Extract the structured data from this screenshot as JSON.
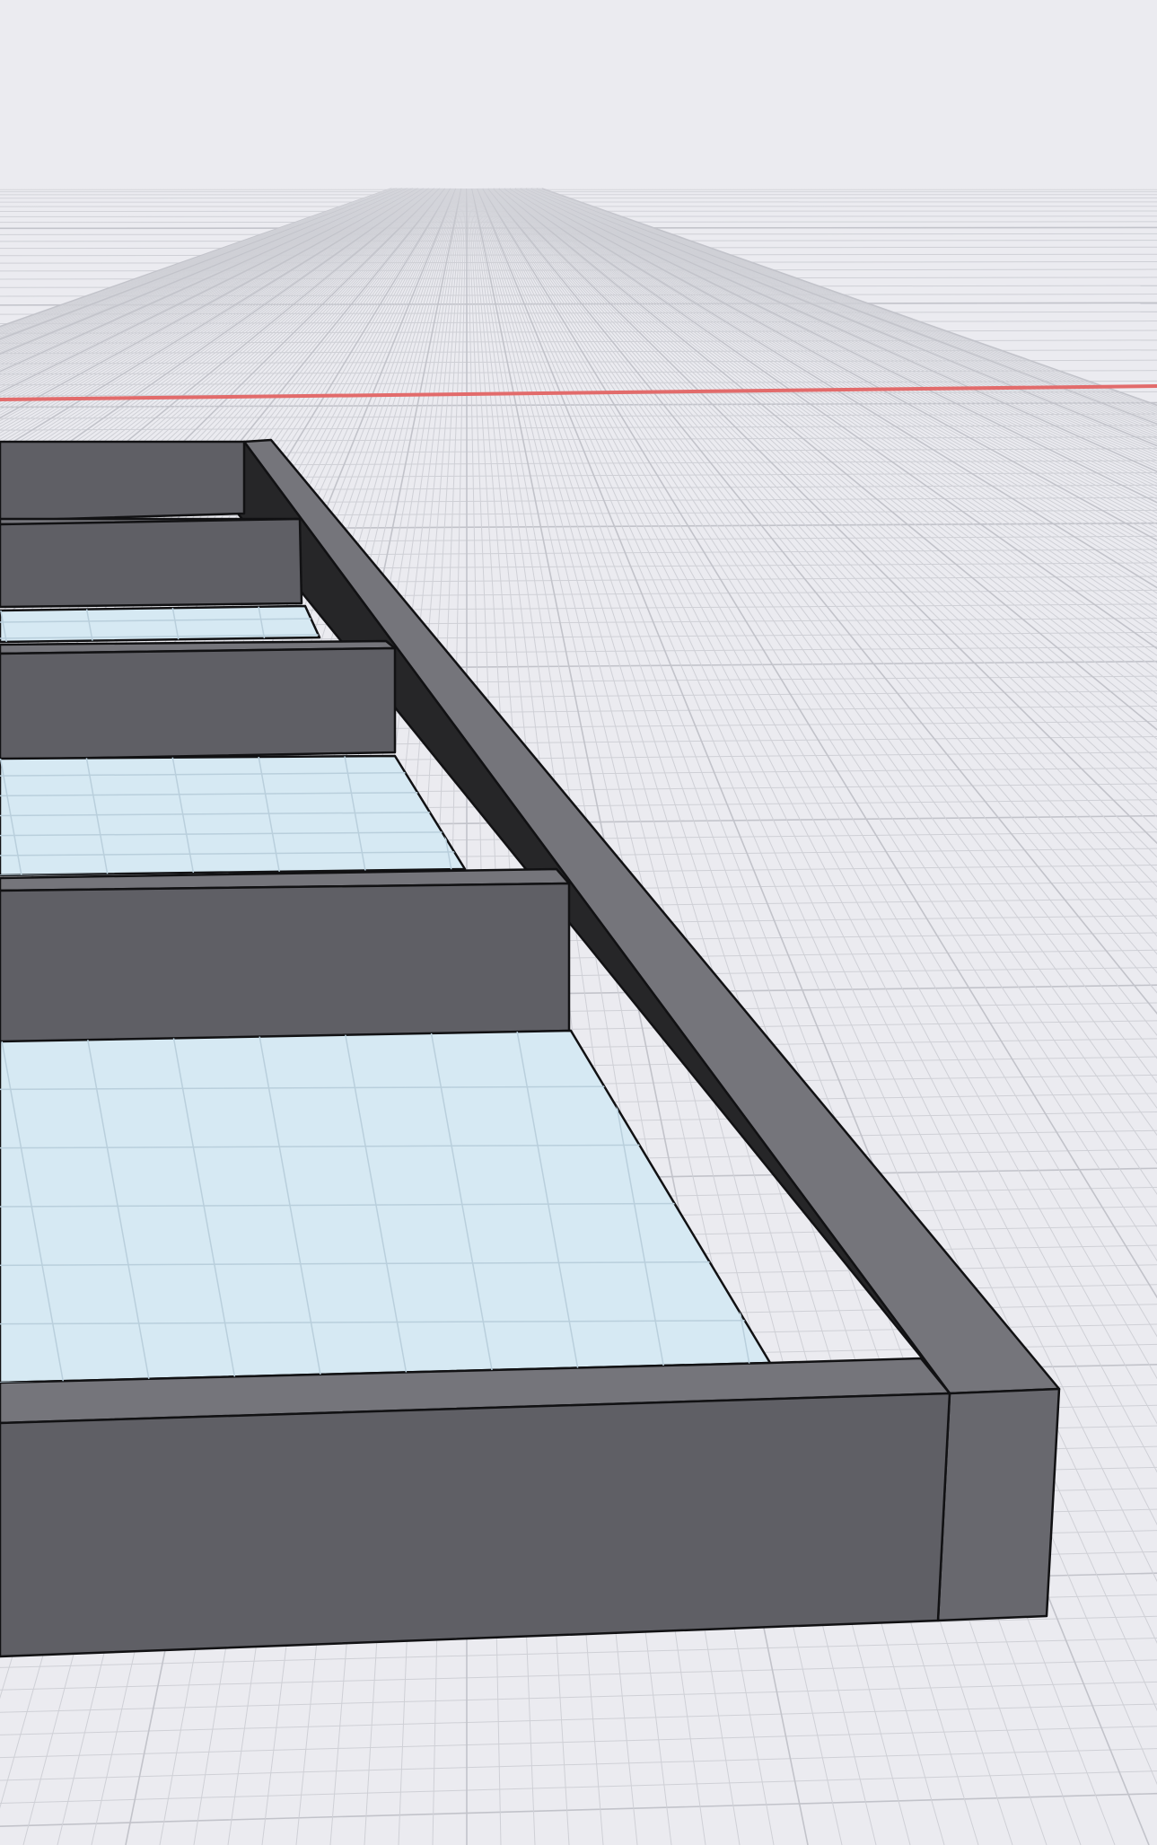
{
  "viewport": {
    "name": "3d-modeling-viewport",
    "colors": {
      "background": "#ebebf0",
      "horizon_fog": "#f4f4f7",
      "grid_line": "#cfd0d6",
      "grid_major_line": "#c2c3ca",
      "axis_x": "#e26b6b",
      "model_top": "#75757b",
      "model_front": "#5f5f65",
      "model_side": "#68686e",
      "model_inner_shadow": "#262628",
      "model_edge": "#111113",
      "floor_glass": "#d6e9f3",
      "floor_glass_grid": "#b9cfdc"
    },
    "visible_objects": [
      "ground-grid",
      "x-axis-line",
      "frame-model"
    ]
  }
}
